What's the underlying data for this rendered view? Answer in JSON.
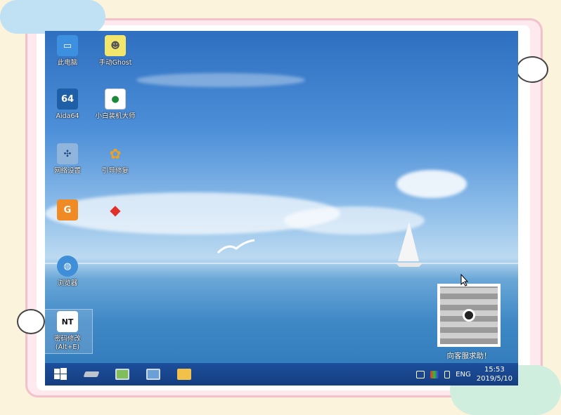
{
  "desktop": {
    "icons": [
      {
        "label": "此电脑",
        "icon": "computer-icon"
      },
      {
        "label": "手动Ghost",
        "icon": "ghost-icon"
      },
      {
        "label": "Aida64",
        "icon": "aida64-icon",
        "glyph": "64"
      },
      {
        "label": "小白装机大师",
        "icon": "installer-icon"
      },
      {
        "label": "网络设置",
        "icon": "network-icon"
      },
      {
        "label": "引导修复",
        "icon": "boot-repair-icon"
      },
      {
        "label": "",
        "icon": "diskgenius-icon"
      },
      {
        "label": "",
        "icon": "red-diamond-icon"
      },
      {
        "label": "浏览器",
        "icon": "browser-icon"
      },
      {
        "label": "密码修改\n(Alt+E)",
        "icon": "password-tool-icon",
        "glyph": "NT"
      }
    ],
    "qr_caption": "向客服求助！"
  },
  "taskbar": {
    "buttons": [
      "start-icon",
      "drive-icon",
      "monitor-icon",
      "network-computer-icon",
      "folder-icon"
    ],
    "language": "ENG",
    "time": "15:53",
    "date": "2019/5/10"
  },
  "colors": {
    "taskbar": "#163e80",
    "sky": "#4d8fd8",
    "frame_pink": "#f2c1c9",
    "background": "#fbf3dc"
  }
}
